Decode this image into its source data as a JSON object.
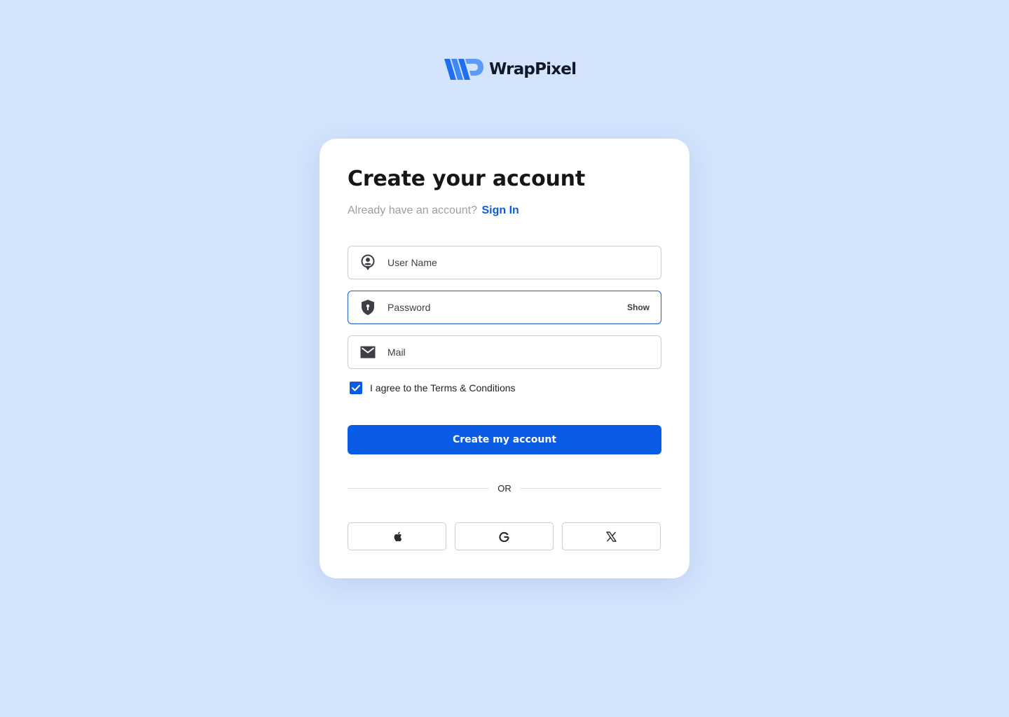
{
  "brand": {
    "name": "WrapPixel",
    "logo_icon": "wrappixel-logo-icon"
  },
  "form": {
    "title": "Create your account",
    "signin_prompt": "Already have an account?",
    "signin_link": "Sign In",
    "fields": {
      "username": {
        "placeholder": "User Name",
        "value": "",
        "icon": "user-pin-icon"
      },
      "password": {
        "placeholder": "Password",
        "value": "",
        "icon": "shield-lock-icon",
        "toggle_label": "Show"
      },
      "mail": {
        "placeholder": "Mail",
        "value": "",
        "icon": "mail-icon"
      }
    },
    "terms": {
      "checked": true,
      "label": "I agree to the Terms & Conditions"
    },
    "submit_label": "Create my account",
    "divider_label": "OR",
    "social_buttons": [
      {
        "icon": "apple-icon"
      },
      {
        "icon": "google-icon"
      },
      {
        "icon": "x-icon"
      }
    ]
  },
  "colors": {
    "background": "#d4e4fd",
    "accent": "#0a5ce6",
    "focus_border": "#1a5fc9",
    "card": "#ffffff"
  }
}
